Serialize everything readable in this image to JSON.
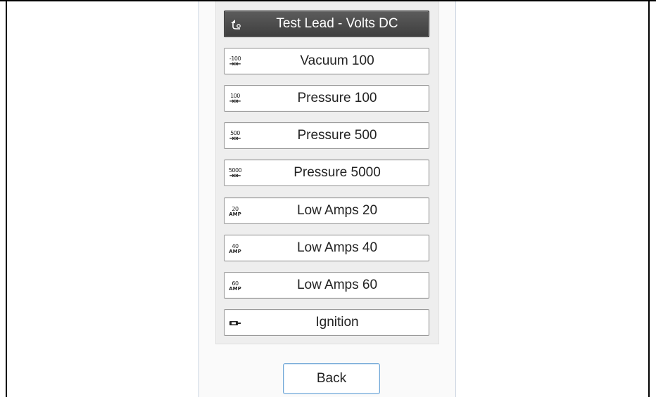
{
  "menu": {
    "items": [
      {
        "label": "Test Lead - Volts DC",
        "icon": "test-lead-icon",
        "icon_text": "",
        "selected": true
      },
      {
        "label": "Vacuum 100",
        "icon": "vacuum-100-icon",
        "icon_text": "-100"
      },
      {
        "label": "Pressure 100",
        "icon": "pressure-100-icon",
        "icon_text": "100"
      },
      {
        "label": "Pressure 500",
        "icon": "pressure-500-icon",
        "icon_text": "500"
      },
      {
        "label": "Pressure 5000",
        "icon": "pressure-5000-icon",
        "icon_text": "5000"
      },
      {
        "label": "Low Amps 20",
        "icon": "low-amps-20-icon",
        "icon_text": "20",
        "icon_sub": "AMP"
      },
      {
        "label": "Low Amps 40",
        "icon": "low-amps-40-icon",
        "icon_text": "40",
        "icon_sub": "AMP"
      },
      {
        "label": "Low Amps 60",
        "icon": "low-amps-60-icon",
        "icon_text": "60",
        "icon_sub": "AMP"
      },
      {
        "label": "Ignition",
        "icon": "ignition-icon",
        "icon_text": ""
      }
    ]
  },
  "back_label": "Back",
  "colors": {
    "selected_bg": "#4a4a4a",
    "back_border": "#6fa6d6",
    "panel_border": "#c9d3e0"
  }
}
